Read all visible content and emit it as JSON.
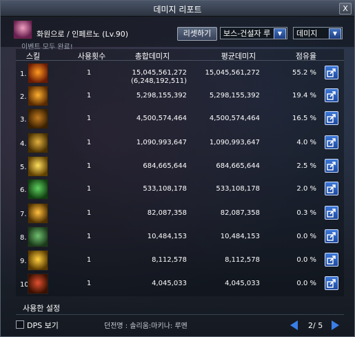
{
  "window": {
    "title": "데미지 리포트",
    "close_label": "X"
  },
  "header": {
    "character": "화원으로 / 인페르노 (Lv.90)",
    "event_text": "이벤트 모두 완료!",
    "reset_label": "리셋하기",
    "boss_select": "보스-건설자 루",
    "metric_select": "데미지"
  },
  "columns": {
    "skill": "스킬",
    "uses": "사용횟수",
    "total": "총합데미지",
    "avg": "평균데미지",
    "share": "점유율"
  },
  "rows": [
    {
      "n": "1.",
      "uses": "1",
      "total": "15,045,561,272",
      "sub": "(6,248,192,511)",
      "avg": "15,045,561,272",
      "share": "55.2  %",
      "c1": "#ff9a20",
      "c2": "#6a1a05"
    },
    {
      "n": "2.",
      "uses": "1",
      "total": "5,298,155,392",
      "sub": "",
      "avg": "5,298,155,392",
      "share": "19.4  %",
      "c1": "#ffb030",
      "c2": "#5a2a00"
    },
    {
      "n": "3.",
      "uses": "1",
      "total": "4,500,574,464",
      "sub": "",
      "avg": "4,500,574,464",
      "share": "16.5  %",
      "c1": "#c07a20",
      "c2": "#3a2000"
    },
    {
      "n": "4.",
      "uses": "1",
      "total": "1,090,993,647",
      "sub": "",
      "avg": "1,090,993,647",
      "share": "4.0  %",
      "c1": "#e0b040",
      "c2": "#4a3000"
    },
    {
      "n": "5.",
      "uses": "1",
      "total": "684,665,644",
      "sub": "",
      "avg": "684,665,644",
      "share": "2.5  %",
      "c1": "#ffe060",
      "c2": "#604000"
    },
    {
      "n": "6.",
      "uses": "1",
      "total": "533,108,178",
      "sub": "",
      "avg": "533,108,178",
      "share": "2.0  %",
      "c1": "#60d060",
      "c2": "#104010"
    },
    {
      "n": "7.",
      "uses": "1",
      "total": "82,087,358",
      "sub": "",
      "avg": "82,087,358",
      "share": "0.3  %",
      "c1": "#ffc040",
      "c2": "#503000"
    },
    {
      "n": "8.",
      "uses": "1",
      "total": "10,484,153",
      "sub": "",
      "avg": "10,484,153",
      "share": "0.0  %",
      "c1": "#70c070",
      "c2": "#1a3a1a"
    },
    {
      "n": "9.",
      "uses": "1",
      "total": "8,112,578",
      "sub": "",
      "avg": "8,112,578",
      "share": "0.0  %",
      "c1": "#ffd040",
      "c2": "#5a3a00"
    },
    {
      "n": "10.",
      "uses": "1",
      "total": "4,045,033",
      "sub": "",
      "avg": "4,045,033",
      "share": "0.0  %",
      "c1": "#e05030",
      "c2": "#3a1000"
    }
  ],
  "footer": {
    "used_settings": "사용한 설정",
    "dps_label": "DPS 보기",
    "bottom_info": "던전명 : 솔리움:마키나: 루멘",
    "page": "2/ 5"
  }
}
